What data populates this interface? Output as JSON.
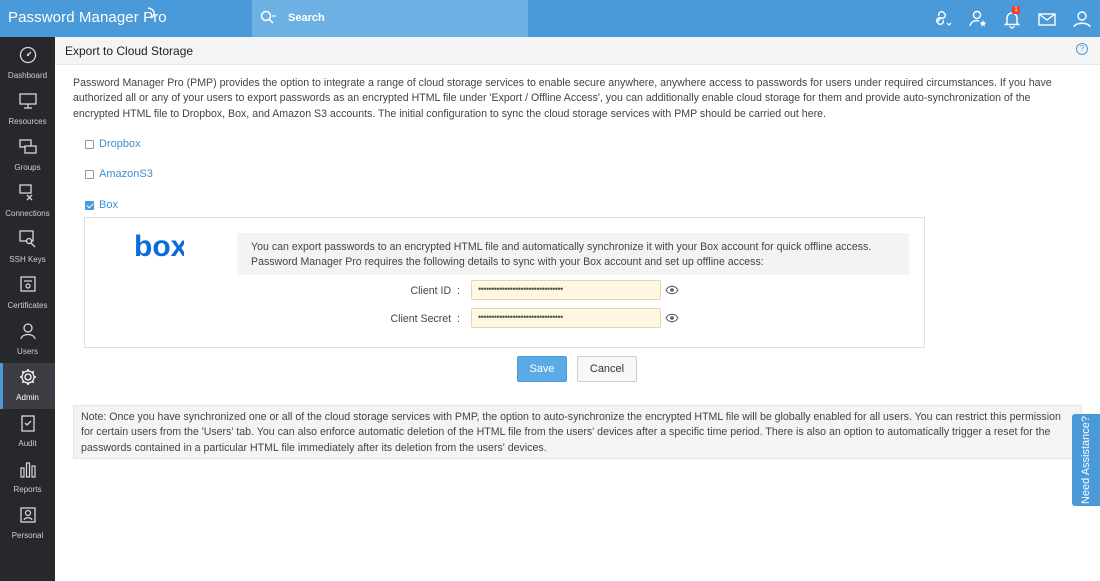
{
  "app": {
    "brand": "Password Manager Pro",
    "search_placeholder": "Search",
    "notification_count": "1",
    "accent_color": "#4a9ad9"
  },
  "header_icons": [
    "link-icon",
    "star-user-icon",
    "bell-icon",
    "mail-icon",
    "user-icon"
  ],
  "sidebar": {
    "items": [
      {
        "label": "Dashboard",
        "icon": "dashboard-icon"
      },
      {
        "label": "Resources",
        "icon": "monitor-icon"
      },
      {
        "label": "Groups",
        "icon": "groups-icon"
      },
      {
        "label": "Connections",
        "icon": "connections-icon"
      },
      {
        "label": "SSH Keys",
        "icon": "key-icon"
      },
      {
        "label": "Certificates",
        "icon": "certificate-icon"
      },
      {
        "label": "Users",
        "icon": "user-icon"
      },
      {
        "label": "Admin",
        "icon": "gear-icon",
        "active": true
      },
      {
        "label": "Audit",
        "icon": "clipboard-icon"
      },
      {
        "label": "Reports",
        "icon": "bar-chart-icon"
      },
      {
        "label": "Personal",
        "icon": "person-card-icon"
      }
    ]
  },
  "page": {
    "title": "Export to Cloud Storage",
    "help": "?",
    "intro": "Password Manager Pro (PMP) provides the option to integrate a range of cloud storage services to enable secure anywhere, anywhere access to passwords for users under required circumstances. If you have authorized all or any of your users to export passwords as an encrypted HTML file under 'Export / Offline Access', you can additionally enable cloud storage for them and provide auto-synchronization of the encrypted HTML file to Dropbox, Box, and Amazon S3 accounts. The initial configuration to sync the cloud storage services with PMP should be carried out here."
  },
  "providers": [
    {
      "label": "Dropbox",
      "checked": false
    },
    {
      "label": "AmazonS3",
      "checked": false
    },
    {
      "label": "Box",
      "checked": true
    }
  ],
  "box_panel": {
    "logo_text": "box",
    "description": "You can export passwords to an encrypted HTML file and automatically synchronize it with your Box account for quick offline access. Password Manager Pro requires the following details to sync with your Box account and set up offline access:",
    "client_id_label": "Client ID",
    "client_id_value": "••••••••••••••••••••••••••••••••",
    "client_secret_label": "Client Secret",
    "client_secret_value": "••••••••••••••••••••••••••••••••",
    "colon": ":"
  },
  "buttons": {
    "save": "Save",
    "cancel": "Cancel"
  },
  "note": "Note: Once you have synchronized one or all of the cloud storage services with PMP, the option to auto-synchronize the encrypted HTML file will be globally enabled for all users. You can restrict this permission for certain users from the 'Users' tab. You can also enforce automatic deletion of the HTML file from the users' devices after a specific time period. There is also an option to automatically trigger a reset for the passwords contained in a particular HTML file immediately after its deletion from the users' devices.",
  "need_assistance": "Need Assistance?"
}
